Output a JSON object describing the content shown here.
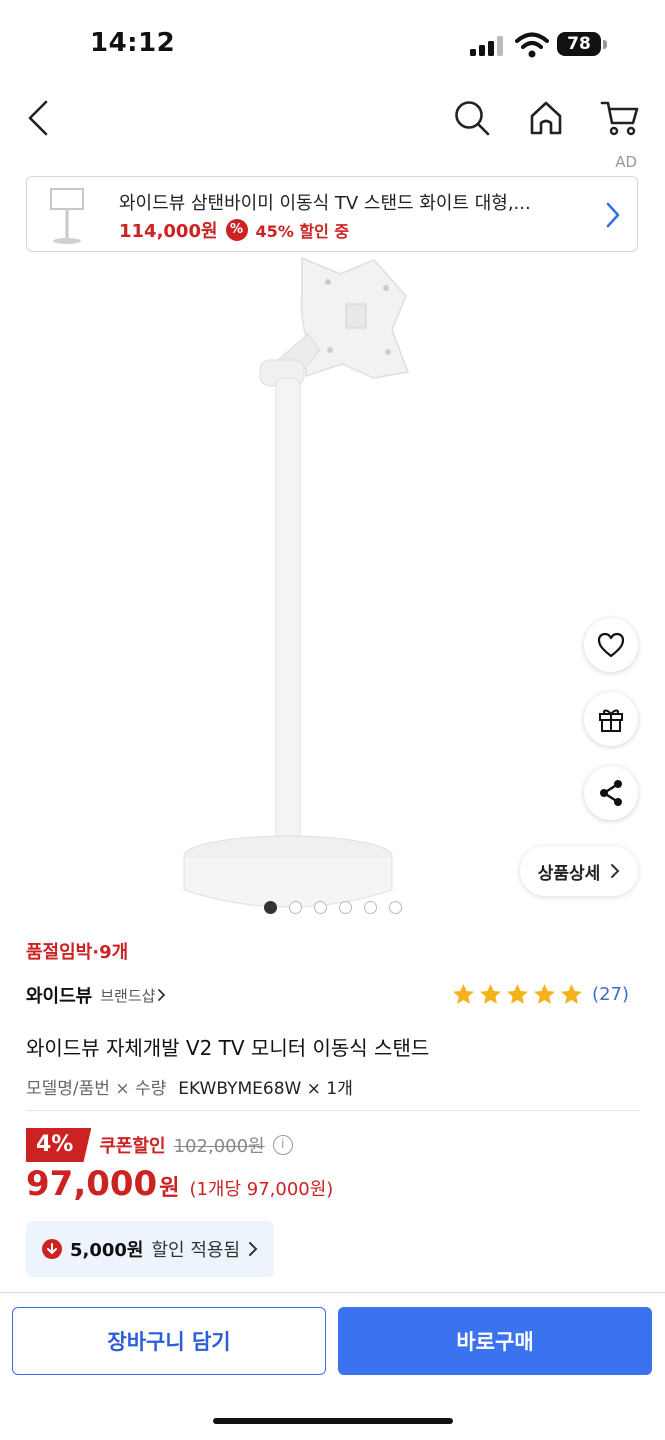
{
  "status_bar": {
    "time": "14:12",
    "battery": "78"
  },
  "nav": {
    "back_icon": "back-chevron-icon",
    "search_icon": "search-icon",
    "home_icon": "home-icon",
    "cart_icon": "cart-icon"
  },
  "ad": {
    "label": "AD",
    "title": "와이드뷰 삼탠바이미 이동식 TV 스탠드 화이트 대형,...",
    "price": "114,000원",
    "discount_icon": "%",
    "discount": "45% 할인 중"
  },
  "gallery": {
    "slide_count": 6,
    "active_slide": 1,
    "detail_label": "상품상세"
  },
  "product": {
    "stock_badge": "품절임박·9개",
    "brand": "와이드뷰",
    "brand_shop": "브랜드샵",
    "rating_stars": 5,
    "review_count": "(27)",
    "title": "와이드뷰 자체개발 V2 TV 모니터 이동식 스탠드",
    "option_label": "모델명/품번 × 수량",
    "option_value": "EKWBYME68W × 1개"
  },
  "price": {
    "discount_rate": "4%",
    "coupon_label": "쿠폰할인",
    "original": "102,000원",
    "info_icon": "i",
    "sale": "97,000",
    "sale_unit": "원",
    "unit_price": "(1개당 97,000원)",
    "applied_amount": "5,000원",
    "applied_text": "할인 적용됨"
  },
  "actions": {
    "cart": "장바구니 담기",
    "buy": "바로구매"
  },
  "colors": {
    "accent_red": "#cc2222",
    "accent_blue": "#3a72f0",
    "star": "#f5b31b"
  }
}
